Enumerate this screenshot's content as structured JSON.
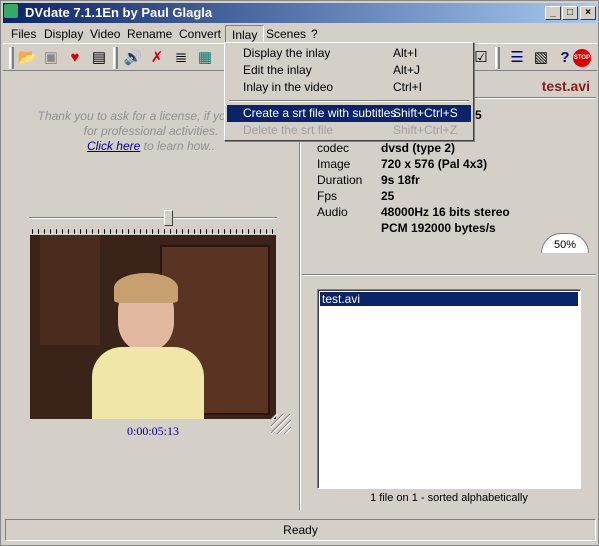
{
  "window": {
    "title": "DVdate 7.1.1En by Paul Glagla"
  },
  "menu": [
    "Files",
    "Display",
    "Video",
    "Rename",
    "Convert",
    "Inlay",
    "Scenes",
    "?"
  ],
  "inlay_menu": [
    {
      "label": "Display the inlay",
      "shortcut": "Alt+I",
      "state": "normal"
    },
    {
      "label": "Edit the inlay",
      "shortcut": "Alt+J",
      "state": "normal"
    },
    {
      "label": "Inlay in the video",
      "shortcut": "Ctrl+I",
      "state": "normal"
    },
    {
      "label": "Create a srt file with subtitles",
      "shortcut": "Shift+Ctrl+S",
      "state": "highlighted"
    },
    {
      "label": "Delete the srt file",
      "shortcut": "Shift+Ctrl+Z",
      "state": "disabled"
    }
  ],
  "license": {
    "line1": "Thank you to ask for a license, if you use it",
    "line2": "for professional activities.",
    "link": "Click here",
    "line3": " to learn how.."
  },
  "file": {
    "name": "test.avi",
    "partial_value": "5",
    "info": [
      {
        "k": "codec",
        "v": "dvsd (type 2)"
      },
      {
        "k": "Image",
        "v": "720 x 576 (Pal 4x3)"
      },
      {
        "k": "Duration",
        "v": "9s 18fr"
      },
      {
        "k": "Fps",
        "v": "25"
      },
      {
        "k": "Audio",
        "v": "48000Hz 16 bits  stereo"
      },
      {
        "k": "",
        "v": "PCM 192000 bytes/s"
      }
    ]
  },
  "gauge": "50%",
  "video": {
    "timecode": "0:00:05:13",
    "position_fraction": 0.56
  },
  "files": {
    "items": [
      "test.avi"
    ],
    "summary": "1 file on 1 - sorted alphabetically"
  },
  "status": "Ready",
  "colors": {
    "title": "#0a246a",
    "highlight": "#0a246a",
    "filename": "#8b1a1a"
  }
}
